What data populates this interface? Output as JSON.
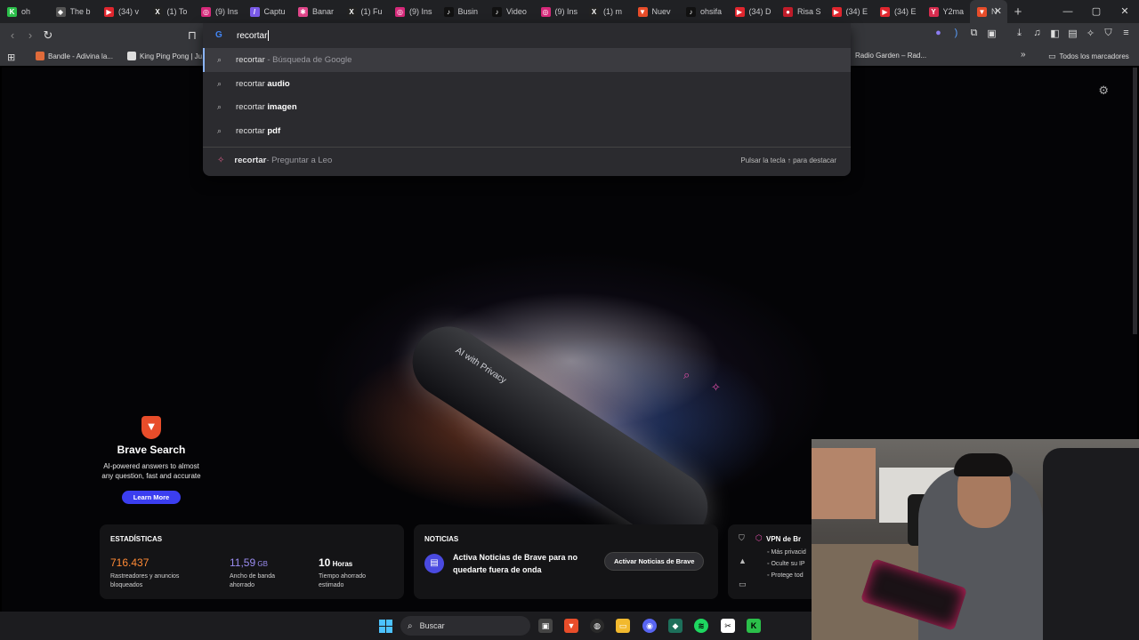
{
  "tabs": [
    {
      "title": "oh",
      "fav": "K",
      "color": "#2bbf4a"
    },
    {
      "title": "The b",
      "fav": "◆",
      "color": "#555"
    },
    {
      "title": "(34) v",
      "fav": "▶",
      "color": "#e0262e"
    },
    {
      "title": "(1) To",
      "fav": "X",
      "color": "#222"
    },
    {
      "title": "(9) Ins",
      "fav": "◎",
      "color": "#d6297a"
    },
    {
      "title": "Captu",
      "fav": "/",
      "color": "#7a5ae8"
    },
    {
      "title": "Banar",
      "fav": "✱",
      "color": "#e0468a"
    },
    {
      "title": "(1) Fu",
      "fav": "X",
      "color": "#222"
    },
    {
      "title": "(9) Ins",
      "fav": "◎",
      "color": "#d6297a"
    },
    {
      "title": "Busin",
      "fav": "♪",
      "color": "#111"
    },
    {
      "title": "Video",
      "fav": "♪",
      "color": "#111"
    },
    {
      "title": "(9) Ins",
      "fav": "◎",
      "color": "#d6297a"
    },
    {
      "title": "(1) m",
      "fav": "X",
      "color": "#222"
    },
    {
      "title": "Nuev",
      "fav": "▼",
      "color": "#e84d2a"
    },
    {
      "title": "ohsifa",
      "fav": "♪",
      "color": "#111"
    },
    {
      "title": "(34) D",
      "fav": "▶",
      "color": "#e0262e"
    },
    {
      "title": "Risa S",
      "fav": "●",
      "color": "#c01d2a"
    },
    {
      "title": "(34) E",
      "fav": "▶",
      "color": "#e0262e"
    },
    {
      "title": "(34) E",
      "fav": "▶",
      "color": "#e0262e"
    },
    {
      "title": "Y2ma",
      "fav": "Y",
      "color": "#d62c4e"
    }
  ],
  "active_tab": {
    "title": "N",
    "fav": "▼",
    "color": "#e84d2a"
  },
  "new_tab": "+",
  "window_controls": {
    "minimize": "—",
    "maximize": "▢",
    "close": "✕"
  },
  "omnibox": {
    "value": "recortar",
    "suggestions": [
      {
        "query": "recortar",
        "bold": "",
        "sub": " - Búsqueda de Google",
        "selected": true
      },
      {
        "query": "recortar ",
        "bold": "audio",
        "sub": "",
        "selected": false
      },
      {
        "query": "recortar ",
        "bold": "imagen",
        "sub": "",
        "selected": false
      },
      {
        "query": "recortar ",
        "bold": "pdf",
        "sub": "",
        "selected": false
      }
    ],
    "leo": {
      "query": "recortar",
      "sub": " - Preguntar a Leo",
      "hint": "Pulsar la tecla ↑ para destacar"
    }
  },
  "bookmarks": {
    "items": [
      "Bandle - Adivina la...",
      "King Ping Pong | Ju...",
      "Radio Garden – Rad..."
    ],
    "overflow": "»",
    "all": "Todos los marcadores"
  },
  "hero": {
    "pill_text": "AI with Privacy"
  },
  "brave_search": {
    "title": "Brave Search",
    "description": "AI-powered answers to almost any question, fast and accurate",
    "button": "Learn More"
  },
  "stats": {
    "title": "ESTADÍSTICAS",
    "items": [
      {
        "value": "716.437",
        "unit": "",
        "label": "Rastreadores y anuncios bloqueados",
        "color": "#ff8a35"
      },
      {
        "value": "11,59",
        "unit": " GB",
        "label": "Ancho de banda ahorrado",
        "color": "#9a8cf0"
      },
      {
        "value": "10",
        "unit": " Horas",
        "label": "Tiempo ahorrado estimado",
        "color": "#ffffff"
      }
    ]
  },
  "news": {
    "title": "NOTICIAS",
    "text": "Activa Noticias de Brave para no quedarte fuera de onda",
    "button": "Activar Noticias de Brave"
  },
  "vpn": {
    "title": "VPN de Br",
    "lines": [
      "Más privacid",
      "Oculte su IP",
      "Protege tod"
    ]
  },
  "taskbar": {
    "search_placeholder": "Buscar"
  },
  "colors": {
    "accent": "#3b3ef0",
    "brave_orange": "#e84d2a"
  }
}
